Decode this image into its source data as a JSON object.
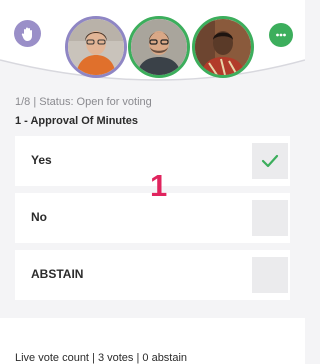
{
  "header": {
    "hand_icon": "raise-hand-icon",
    "chat_icon": "chat-icon",
    "participants": [
      {
        "name": "participant-1",
        "ring_color": "#8f86c4"
      },
      {
        "name": "participant-2",
        "ring_color": "#3cae5c"
      },
      {
        "name": "participant-3",
        "ring_color": "#3cae5c"
      }
    ]
  },
  "vote": {
    "meta": "1/8 | Status: Open for voting",
    "question": "1 - Approval Of Minutes",
    "options": [
      {
        "label": "Yes",
        "selected": true
      },
      {
        "label": "No",
        "selected": false
      },
      {
        "label": "ABSTAIN",
        "selected": false
      }
    ],
    "marker": "1"
  },
  "footer": {
    "live_count": "Live vote count | 3 votes | 0 abstain"
  },
  "colors": {
    "accent_purple": "#9a8fc8",
    "accent_green": "#3cae5c",
    "marker_red": "#e0245e"
  }
}
